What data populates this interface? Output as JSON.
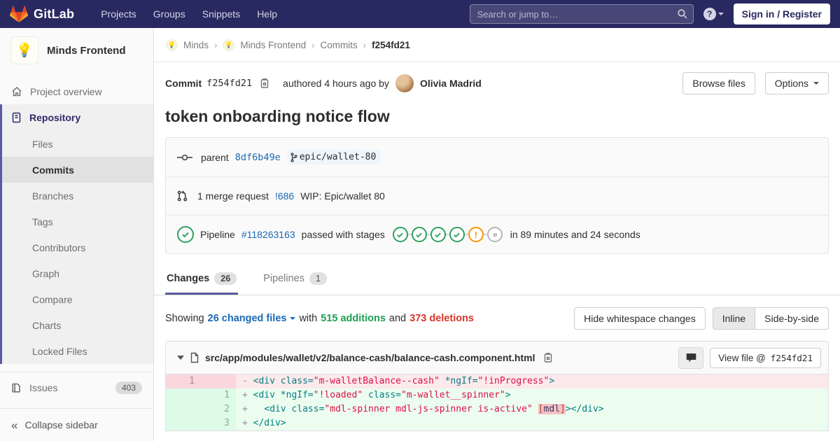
{
  "navbar": {
    "brand": "GitLab",
    "items": [
      "Projects",
      "Groups",
      "Snippets",
      "Help"
    ],
    "search_placeholder": "Search or jump to…",
    "signin_label": "Sign in / Register"
  },
  "sidebar": {
    "project_name": "Minds Frontend",
    "project_avatar_emoji": "💡",
    "project_overview": "Project overview",
    "repository_label": "Repository",
    "repo_items": [
      "Files",
      "Commits",
      "Branches",
      "Tags",
      "Contributors",
      "Graph",
      "Compare",
      "Charts",
      "Locked Files"
    ],
    "active_repo_item": "Commits",
    "issues_label": "Issues",
    "issues_count": "403",
    "collapse_label": "Collapse sidebar"
  },
  "breadcrumb": {
    "group": "Minds",
    "project": "Minds Frontend",
    "section": "Commits",
    "current": "f254fd21"
  },
  "commit_header": {
    "commit_label": "Commit",
    "sha": "f254fd21",
    "authored_text": "authored 4 hours ago by",
    "author": "Olivia Madrid",
    "browse_files_label": "Browse files",
    "options_label": "Options"
  },
  "commit": {
    "title": "token onboarding notice flow",
    "parent_label": "parent",
    "parent_sha": "8df6b49e",
    "branch": "epic/wallet-80",
    "mr_count_text": "1 merge request",
    "mr_ref": "!686",
    "mr_title": "WIP: Epic/wallet 80",
    "pipeline_label": "Pipeline",
    "pipeline_id": "#118263163",
    "pipeline_status_text": "passed with stages",
    "pipeline_stages": [
      "success",
      "success",
      "success",
      "success",
      "warning",
      "skipped"
    ],
    "pipeline_duration": "in 89 minutes and 24 seconds"
  },
  "tabs": {
    "changes_label": "Changes",
    "changes_count": "26",
    "pipelines_label": "Pipelines",
    "pipelines_count": "1"
  },
  "changes_bar": {
    "showing": "Showing",
    "changed_files": "26 changed files",
    "with": "with",
    "additions": "515 additions",
    "and": "and",
    "deletions": "373 deletions",
    "hide_whitespace_label": "Hide whitespace changes",
    "inline_label": "Inline",
    "side_by_side_label": "Side-by-side"
  },
  "diff": {
    "file_path": "src/app/modules/wallet/v2/balance-cash/balance-cash.component.html",
    "view_file_label": "View file @",
    "view_file_sha": "f254fd21",
    "lines": [
      {
        "type": "del",
        "old": "1",
        "new": "",
        "segments": [
          {
            "c": "m",
            "t": "- "
          },
          {
            "c": "t",
            "t": "<div"
          },
          {
            "c": "p",
            "t": " "
          },
          {
            "c": "a",
            "t": "class="
          },
          {
            "c": "s",
            "t": "\"m-walletBalance--cash\""
          },
          {
            "c": "p",
            "t": " "
          },
          {
            "c": "a",
            "t": "*ngIf="
          },
          {
            "c": "s",
            "t": "\"!inProgress\""
          },
          {
            "c": "t",
            "t": ">"
          }
        ]
      },
      {
        "type": "add",
        "old": "",
        "new": "1",
        "segments": [
          {
            "c": "m",
            "t": "+ "
          },
          {
            "c": "t",
            "t": "<div"
          },
          {
            "c": "p",
            "t": " "
          },
          {
            "c": "a",
            "t": "*ngIf="
          },
          {
            "c": "s",
            "t": "\"!loaded\""
          },
          {
            "c": "p",
            "t": " "
          },
          {
            "c": "a",
            "t": "class="
          },
          {
            "c": "s",
            "t": "\"m-wallet__spinner\""
          },
          {
            "c": "t",
            "t": ">"
          }
        ]
      },
      {
        "type": "add",
        "old": "",
        "new": "2",
        "segments": [
          {
            "c": "m",
            "t": "+ "
          },
          {
            "c": "p",
            "t": "  "
          },
          {
            "c": "t",
            "t": "<div"
          },
          {
            "c": "p",
            "t": " "
          },
          {
            "c": "a",
            "t": "class="
          },
          {
            "c": "s",
            "t": "\"mdl-spinner mdl-js-spinner is-active\""
          },
          {
            "c": "p",
            "t": " "
          },
          {
            "c": "hb",
            "t": "["
          },
          {
            "c": "ht",
            "t": "mdl"
          },
          {
            "c": "hb",
            "t": "]"
          },
          {
            "c": "t",
            "t": "></div>"
          }
        ]
      },
      {
        "type": "add",
        "old": "",
        "new": "3",
        "segments": [
          {
            "c": "m",
            "t": "+ "
          },
          {
            "c": "t",
            "t": "</div>"
          }
        ]
      }
    ]
  },
  "colors": {
    "navbar_bg": "#292961",
    "sidebar_active_border": "#5a5aa5",
    "link_blue": "#1b69b6",
    "additions_green": "#1e9e54",
    "deletions_red": "#d9352a",
    "pipeline_success": "#2da160",
    "pipeline_warning": "#fc9403",
    "diff_del_bg": "#fbe9eb",
    "diff_add_bg": "#ecfdf0"
  }
}
